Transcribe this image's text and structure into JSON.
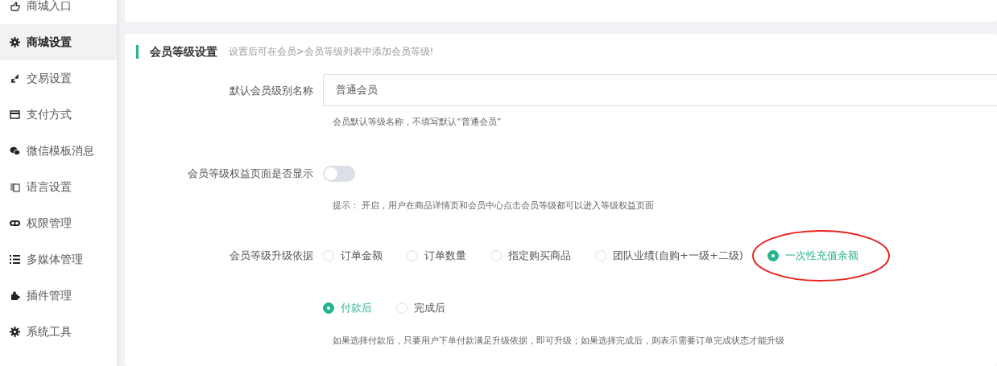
{
  "sidebar": {
    "items": [
      {
        "label": "商城入口",
        "selected": false
      },
      {
        "label": "商城设置",
        "selected": true
      },
      {
        "label": "交易设置",
        "selected": false
      },
      {
        "label": "支付方式",
        "selected": false
      },
      {
        "label": "微信模板消息",
        "selected": false
      },
      {
        "label": "语言设置",
        "selected": false
      },
      {
        "label": "权限管理",
        "selected": false
      },
      {
        "label": "多媒体管理",
        "selected": false
      },
      {
        "label": "插件管理",
        "selected": false
      },
      {
        "label": "系统工具",
        "selected": false
      }
    ]
  },
  "section": {
    "title": "会员等级设置",
    "subtitle": "设置后可在会员>会员等级列表中添加会员等级!",
    "fields": [
      {
        "kind": "input",
        "label": "默认会员级别名称",
        "value": "普通会员",
        "help": "会员默认等级名称，不填写默认“普通会员”"
      },
      {
        "kind": "switch",
        "label": "会员等级权益页面是否显示",
        "on": false,
        "help": "提示： 开启，用户在商品详情页和会员中心点击会员等级都可以进入等级权益页面"
      },
      {
        "kind": "radio",
        "label": "会员等级升级依据",
        "options": [
          {
            "label": "订单金额",
            "selected": false
          },
          {
            "label": "订单数量",
            "selected": false
          },
          {
            "label": "指定购买商品",
            "selected": false
          },
          {
            "label": "团队业绩(自购+一级+二级)",
            "selected": false
          },
          {
            "label": "一次性充值余额",
            "selected": true
          }
        ]
      },
      {
        "kind": "radio",
        "options": [
          {
            "label": "付款后",
            "selected": true
          },
          {
            "label": "完成后",
            "selected": false
          }
        ],
        "help": "如果选择付款后，只要用户下单付款满足升级依据，即可升级；如果选择完成后，则表示需要订单完成状态才能升级"
      }
    ]
  }
}
